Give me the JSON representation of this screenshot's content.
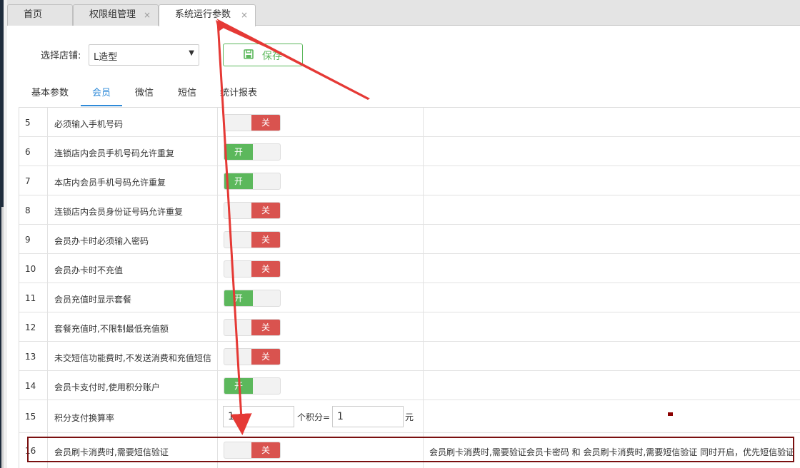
{
  "tabs": [
    {
      "label": "首页",
      "closable": false
    },
    {
      "label": "权限组管理",
      "closable": true
    },
    {
      "label": "系统运行参数",
      "closable": true,
      "active": true
    }
  ],
  "close_glyph": "×",
  "toolbar": {
    "store_label": "选择店铺:",
    "store_value": "L造型",
    "select_caret": "▼",
    "save_label": "保存"
  },
  "subtabs": [
    {
      "label": "基本参数"
    },
    {
      "label": "会员",
      "active": true
    },
    {
      "label": "微信"
    },
    {
      "label": "短信"
    },
    {
      "label": "统计报表"
    }
  ],
  "rows": [
    {
      "num": "5",
      "name": "必须输入手机号码",
      "state": "off",
      "label": "关"
    },
    {
      "num": "6",
      "name": "连锁店内会员手机号码允许重复",
      "state": "on",
      "label": "开"
    },
    {
      "num": "7",
      "name": "本店内会员手机号码允许重复",
      "state": "on",
      "label": "开"
    },
    {
      "num": "8",
      "name": "连锁店内会员身份证号码允许重复",
      "state": "off",
      "label": "关"
    },
    {
      "num": "9",
      "name": "会员办卡时必须输入密码",
      "state": "off",
      "label": "关"
    },
    {
      "num": "10",
      "name": "会员办卡时不充值",
      "state": "off",
      "label": "关"
    },
    {
      "num": "11",
      "name": "会员充值时显示套餐",
      "state": "on",
      "label": "开"
    },
    {
      "num": "12",
      "name": "套餐充值时,不限制最低充值额",
      "state": "off",
      "label": "关"
    },
    {
      "num": "13",
      "name": "未交短信功能费时,不发送消费和充值短信",
      "state": "off",
      "label": "关"
    },
    {
      "num": "14",
      "name": "会员卡支付时,使用积分账户",
      "state": "on",
      "label": "开"
    }
  ],
  "exchange_row": {
    "num": "15",
    "name": "积分支付换算率",
    "input1": "1",
    "mid_label": "个积分=",
    "input2": "1",
    "unit": "元"
  },
  "sms_row": {
    "num": "16",
    "name": "会员刷卡消费时,需要短信验证",
    "state": "off",
    "label": "关",
    "desc": "会员刷卡消费时,需要验证会员卡密码 和 会员刷卡消费时,需要短信验证 同时开启，优先短信验证"
  },
  "colors": {
    "on": "#5cb85c",
    "off": "#d9534f",
    "accent": "#2e8ad8",
    "annotation": "#e53935",
    "highlight_border": "#7a1010"
  },
  "icons": {
    "save": "save-icon"
  }
}
